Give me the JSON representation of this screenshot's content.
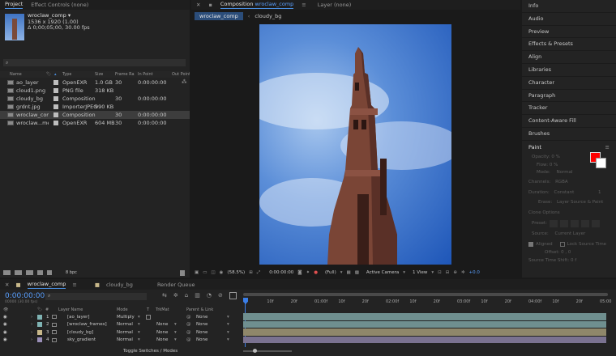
{
  "project_panel": {
    "tabs": [
      "Project",
      "Effect Controls (none)"
    ],
    "preview_name": "wroclaw_comp ▾",
    "preview_dims": "1536 x 1920 (1.00)",
    "preview_duration": "Δ 0;00;05;00, 30.00 fps",
    "search_placeholder": "",
    "columns": [
      "Name",
      "Type",
      "Size",
      "Frame Ra...",
      "In Point",
      "Out Point"
    ],
    "items": [
      {
        "name": "ao_layer",
        "type": "OpenEXR",
        "size": "1.0 GB",
        "fps": "30",
        "in": "0:00:00:00",
        "color": "#bdbdbd"
      },
      {
        "name": "cloud1.png",
        "type": "PNG file",
        "size": "318 KB",
        "fps": "",
        "in": "",
        "color": "#bdbdbd"
      },
      {
        "name": "cloudy_bg",
        "type": "Composition",
        "size": "",
        "fps": "30",
        "in": "0:00:00:00",
        "color": "#bdbdbd"
      },
      {
        "name": "grdnt.jpg",
        "type": "ImporterJPEG",
        "size": "990 KB",
        "fps": "",
        "in": "",
        "color": "#bdbdbd"
      },
      {
        "name": "wroclaw_comp",
        "type": "Composition",
        "size": "",
        "fps": "30",
        "in": "0:00:00:00",
        "color": "#bdbdbd"
      },
      {
        "name": "wroclaw...mes",
        "type": "OpenEXR",
        "size": "604 MB",
        "fps": "30",
        "in": "0:00:00:00",
        "color": "#bdbdbd"
      }
    ],
    "bpc": "8 bpc"
  },
  "comp_panel": {
    "tab_label": "Composition",
    "tab_comp": "wroclaw_comp",
    "layer_tab": "Layer (none)",
    "breadcrumbs": [
      "wroclaw_comp",
      "cloudy_bg"
    ],
    "zoom": "(58.5%)",
    "timecode": "0:00:00:00",
    "resolution": "(Full)",
    "camera": "Active Camera",
    "view": "1 View",
    "exposure": "+0.0"
  },
  "right_panel": {
    "items": [
      "Info",
      "Audio",
      "Preview",
      "Effects & Presets",
      "Align",
      "Libraries",
      "Character",
      "Paragraph",
      "Tracker",
      "Content-Aware Fill",
      "Brushes"
    ],
    "paint": {
      "title": "Paint",
      "opacity_label": "Opacity:",
      "opacity": "0 %",
      "flow_label": "Flow:",
      "flow": "0 %",
      "mode_label": "Mode:",
      "mode": "Normal",
      "channels_label": "Channels:",
      "channels": "RGBA",
      "duration_label": "Duration:",
      "duration": "Constant",
      "duration_value": "1",
      "erase_label": "Erase:",
      "erase": "Layer Source & Paint",
      "clone_options": "Clone Options",
      "preset_label": "Preset:",
      "source_label": "Source:",
      "source": "Current Layer",
      "aligned": "Aligned",
      "lock_source_time": "Lock Source Time",
      "offset_label": "Offset:",
      "offset": "0 , 0",
      "source_time_shift": "Source Time Shift: 0 f",
      "fg_color": "#ff0000",
      "bg_color": "#ffffff"
    }
  },
  "timeline": {
    "tabs": [
      "wroclaw_comp",
      "cloudy_bg",
      "Render Queue"
    ],
    "timecode": "0:00:00:00",
    "timecode_sub": "00000 (30.00 fps)",
    "columns": [
      "#",
      "Layer Name",
      "Mode",
      "T",
      "TrkMat",
      "Parent & Link"
    ],
    "layers": [
      {
        "num": "1",
        "name": "[ao_layer]",
        "mode": "Multiply",
        "trkmat": "",
        "parent": "None",
        "color": "#7fb3b3",
        "bar": "#6f8f8f"
      },
      {
        "num": "2",
        "name": "[wroclaw_frames]",
        "mode": "Normal",
        "trkmat": "None",
        "parent": "None",
        "color": "#7fb3b3",
        "bar": "#6f8f8f"
      },
      {
        "num": "3",
        "name": "[cloudy_bg]",
        "mode": "Normal",
        "trkmat": "None",
        "parent": "None",
        "color": "#c8b88a",
        "bar": "#8f876a"
      },
      {
        "num": "4",
        "name": "sky_gradient",
        "mode": "Normal",
        "trkmat": "None",
        "parent": "None",
        "color": "#9a8fb8",
        "bar": "#7a7290"
      }
    ],
    "ruler_labels": [
      "0f",
      "10f",
      "20f",
      "01:00f",
      "10f",
      "20f",
      "02:00f",
      "10f",
      "20f",
      "03:00f",
      "10f",
      "20f",
      "04:00f",
      "10f",
      "20f",
      "05:00"
    ],
    "toggle_label": "Toggle Switches / Modes"
  }
}
